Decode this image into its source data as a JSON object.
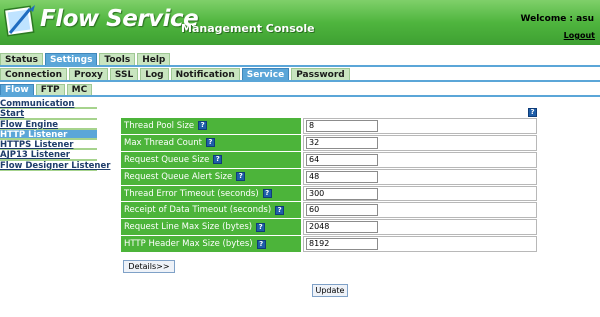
{
  "header": {
    "brand": "Flow Service",
    "subtitle": "Management Console",
    "welcome": "Welcome : asu",
    "logout": "Logout"
  },
  "tabs_primary": [
    {
      "label": "Status",
      "active": false
    },
    {
      "label": "Settings",
      "active": true
    },
    {
      "label": "Tools",
      "active": false
    },
    {
      "label": "Help",
      "active": false
    }
  ],
  "tabs_secondary": [
    {
      "label": "Connection",
      "active": false
    },
    {
      "label": "Proxy",
      "active": false
    },
    {
      "label": "SSL",
      "active": false
    },
    {
      "label": "Log",
      "active": false
    },
    {
      "label": "Notification",
      "active": false
    },
    {
      "label": "Service",
      "active": true
    },
    {
      "label": "Password",
      "active": false
    }
  ],
  "tabs_tertiary": [
    {
      "label": "Flow",
      "active": true
    },
    {
      "label": "FTP",
      "active": false
    },
    {
      "label": "MC",
      "active": false
    }
  ],
  "sidebar": [
    {
      "label": "Communication",
      "active": false
    },
    {
      "label": "Start",
      "active": false
    },
    {
      "label": "Flow Engine",
      "active": false
    },
    {
      "label": "HTTP Listener",
      "active": true
    },
    {
      "label": "HTTPS Listener",
      "active": false
    },
    {
      "label": "AJP13 Listener",
      "active": false
    },
    {
      "label": "Flow Designer Listener",
      "active": false
    }
  ],
  "help_icon": "?",
  "form": {
    "rows": [
      {
        "label": "Thread Pool Size",
        "value": "8"
      },
      {
        "label": "Max Thread Count",
        "value": "32"
      },
      {
        "label": "Request Queue Size",
        "value": "64"
      },
      {
        "label": "Request Queue Alert Size",
        "value": "48"
      },
      {
        "label": "Thread Error Timeout (seconds)",
        "value": "300"
      },
      {
        "label": "Receipt of Data Timeout (seconds)",
        "value": "60"
      },
      {
        "label": "Request Line Max Size (bytes)",
        "value": "2048"
      },
      {
        "label": "HTTP Header Max Size (bytes)",
        "value": "8192"
      }
    ]
  },
  "buttons": {
    "details": "Details>>",
    "update": "Update"
  },
  "colors": {
    "header_green": "#4fb53e",
    "label_green": "#4cb43a",
    "active_blue": "#5ba6d8",
    "inactive_tab": "#c9e5c0",
    "sidebar_divider": "#a6d38d"
  }
}
